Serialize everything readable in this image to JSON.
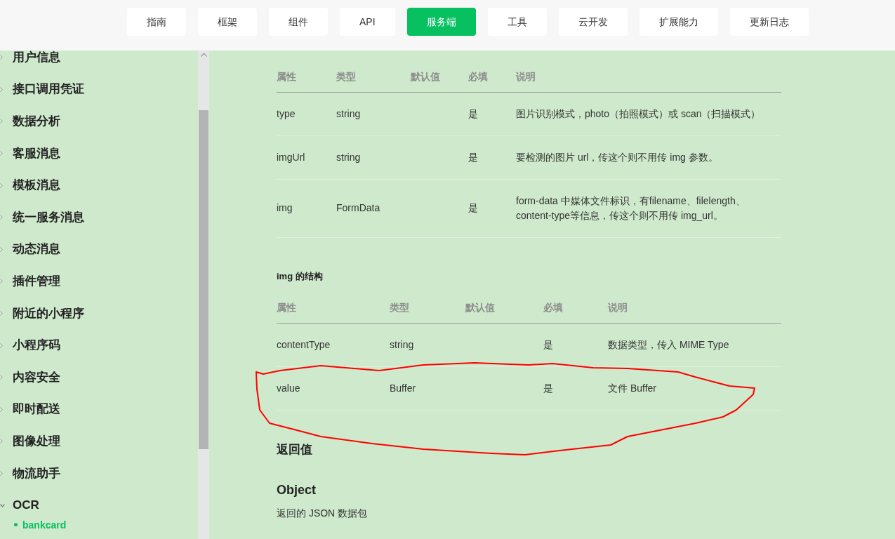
{
  "nav": {
    "tabs": [
      {
        "label": "指南",
        "selected": false
      },
      {
        "label": "框架",
        "selected": false
      },
      {
        "label": "组件",
        "selected": false
      },
      {
        "label": "API",
        "selected": false
      },
      {
        "label": "服务端",
        "selected": true
      },
      {
        "label": "工具",
        "selected": false
      },
      {
        "label": "云开发",
        "selected": false
      },
      {
        "label": "扩展能力",
        "selected": false
      },
      {
        "label": "更新日志",
        "selected": false
      }
    ]
  },
  "sidebar": {
    "items": [
      {
        "label": "用户信息",
        "expanded": false
      },
      {
        "label": "接口调用凭证",
        "expanded": false
      },
      {
        "label": "数据分析",
        "expanded": false
      },
      {
        "label": "客服消息",
        "expanded": false
      },
      {
        "label": "模板消息",
        "expanded": false
      },
      {
        "label": "统一服务消息",
        "expanded": false
      },
      {
        "label": "动态消息",
        "expanded": false
      },
      {
        "label": "插件管理",
        "expanded": false
      },
      {
        "label": "附近的小程序",
        "expanded": false
      },
      {
        "label": "小程序码",
        "expanded": false
      },
      {
        "label": "内容安全",
        "expanded": false
      },
      {
        "label": "即时配送",
        "expanded": false
      },
      {
        "label": "图像处理",
        "expanded": false
      },
      {
        "label": "物流助手",
        "expanded": false
      },
      {
        "label": "OCR",
        "expanded": true,
        "children": [
          {
            "label": "bankcard",
            "selected": true
          }
        ]
      }
    ]
  },
  "content": {
    "sections": [
      {
        "kind": "table",
        "columns": [
          "属性",
          "类型",
          "默认值",
          "必填",
          "说明"
        ],
        "rows": [
          {
            "name": "type",
            "type": "string",
            "required": "是",
            "description": "图片识别模式，photo（拍照模式）或 scan（扫描模式）"
          },
          {
            "name": "imgUrl",
            "type": "string",
            "required": "是",
            "description": "要检测的图片 url，传这个则不用传 img 参数。"
          },
          {
            "name": "img",
            "type": "FormData",
            "required": "是",
            "description": "form-data 中媒体文件标识，有filename、filelength、content-type等信息，传这个则不用传 img_url。"
          }
        ]
      },
      {
        "kind": "subheading",
        "text": "img 的结构"
      },
      {
        "kind": "table",
        "columns": [
          "属性",
          "类型",
          "默认值",
          "必填",
          "说明"
        ],
        "rows": [
          {
            "name": "contentType",
            "type": "string",
            "required": "是",
            "description": "数据类型，传入 MIME Type"
          },
          {
            "name": "value",
            "type": "Buffer",
            "required": "是",
            "description": "文件 Buffer"
          }
        ]
      },
      {
        "kind": "heading",
        "text": "返回值"
      },
      {
        "kind": "type_heading",
        "text": "Object"
      },
      {
        "kind": "paragraph",
        "text": "返回的 JSON 数据包"
      }
    ]
  }
}
